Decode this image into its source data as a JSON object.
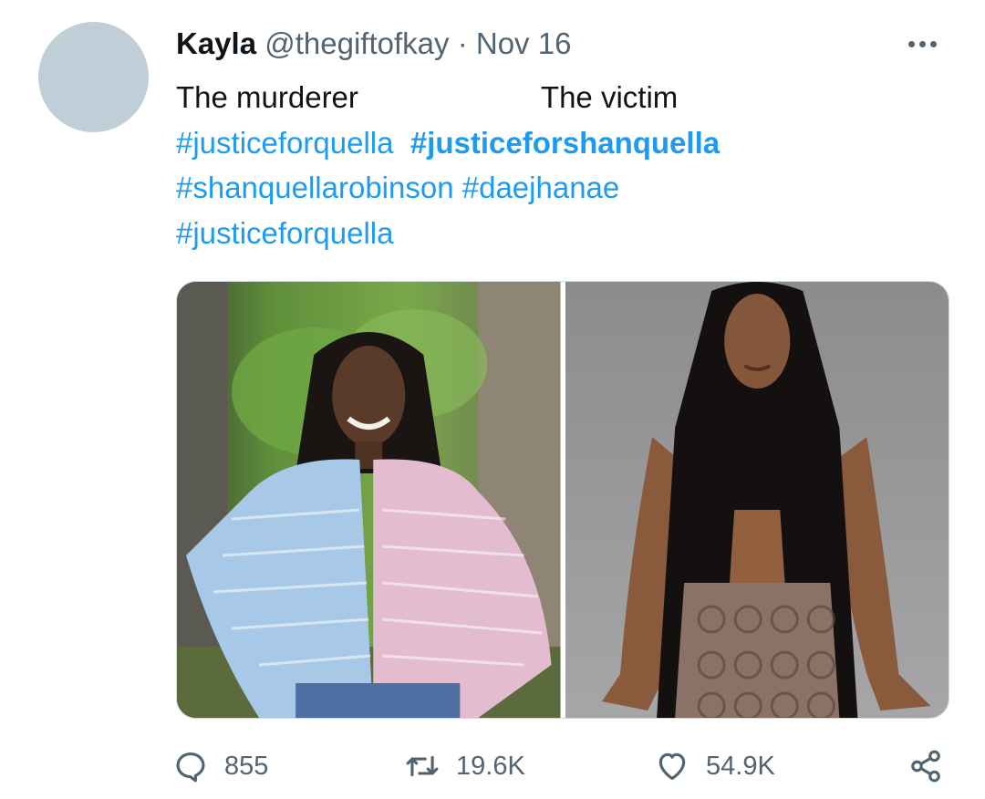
{
  "tweet": {
    "author_name": "Kayla",
    "author_handle": "@thegiftofkay",
    "separator": "·",
    "timestamp": "Nov 16",
    "text_left": "The murderer",
    "text_right": "The victim",
    "hashtags": {
      "h1": "#justiceforquella",
      "h2": "#justiceforshanquella",
      "h3": "#shanquellarobinson",
      "h4": "#daejhanae",
      "h5": "#justiceforquella"
    }
  },
  "actions": {
    "replies": "855",
    "retweets": "19.6K",
    "likes": "54.9K"
  },
  "icons": {
    "reply": "reply-icon",
    "retweet": "retweet-icon",
    "like": "heart-icon",
    "share": "share-icon",
    "more": "more-icon"
  },
  "colors": {
    "link": "#1d9bf0",
    "secondary_text": "#536471",
    "avatar_placeholder": "#c0ced8"
  }
}
